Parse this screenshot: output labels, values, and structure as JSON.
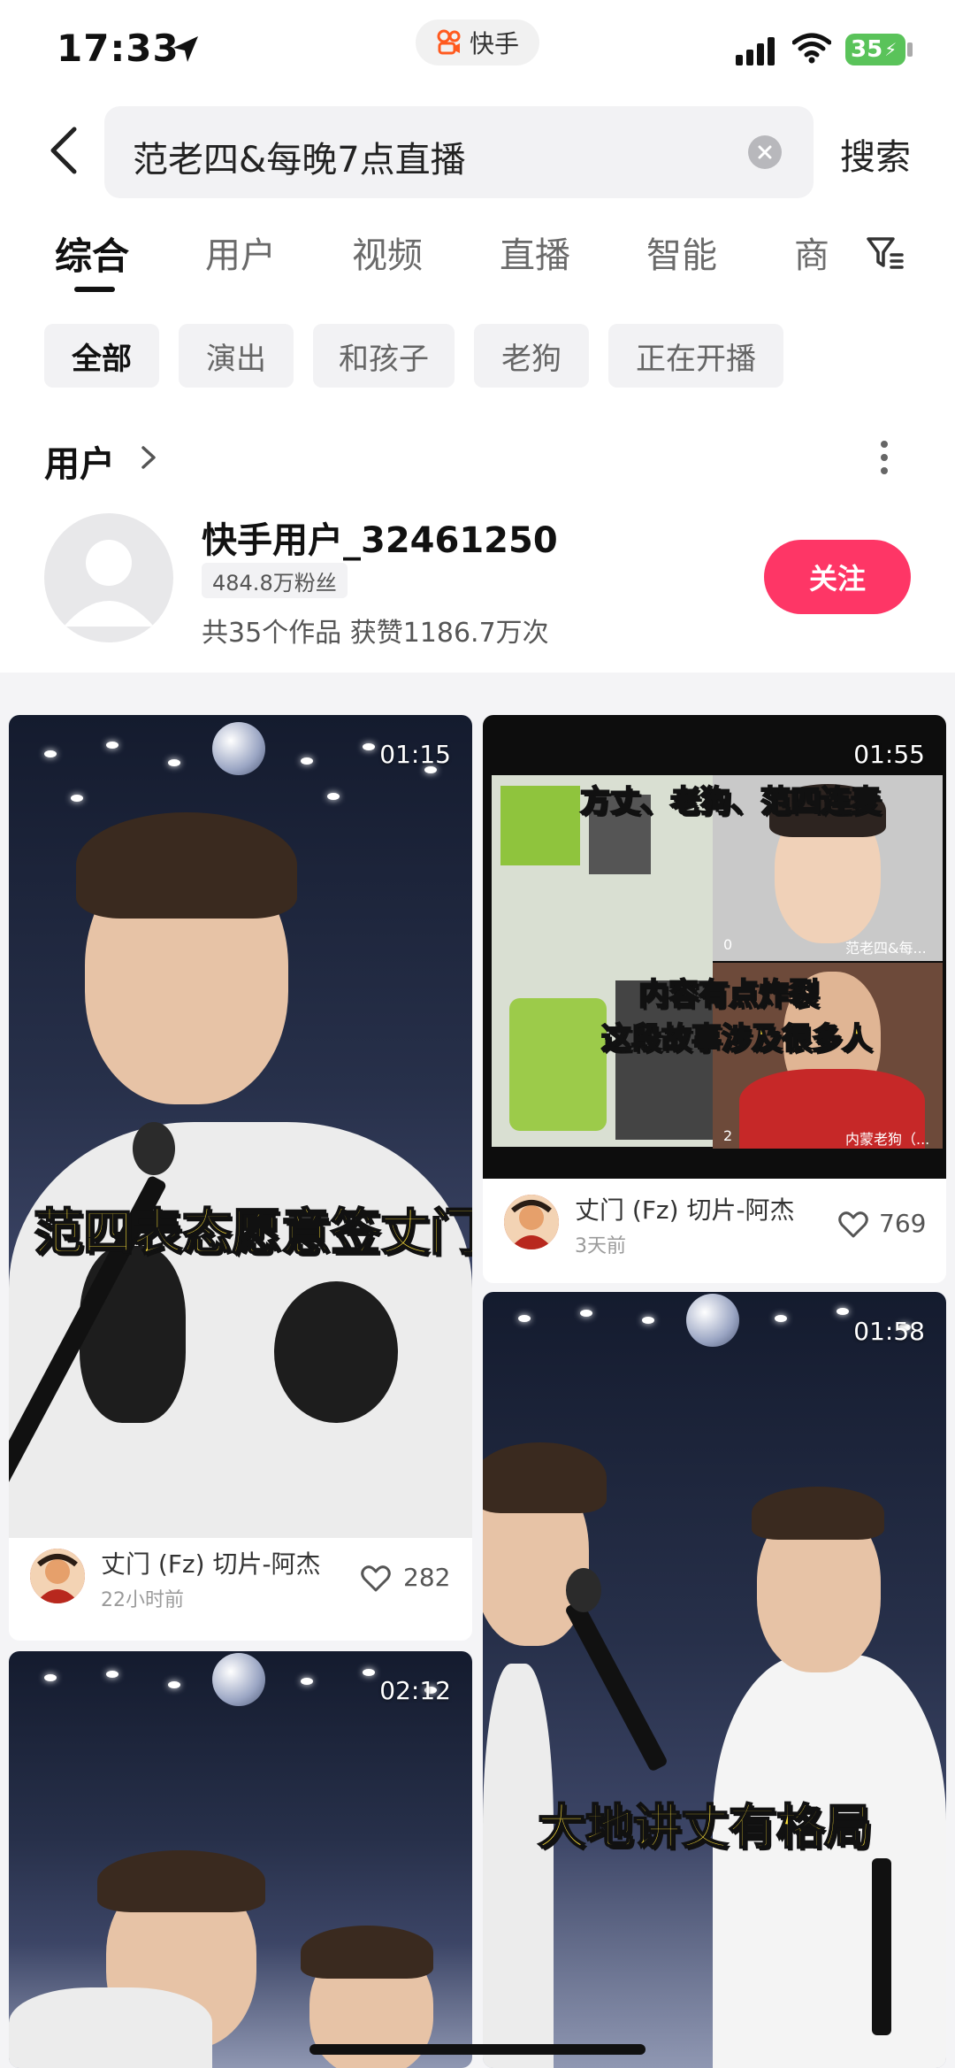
{
  "status_bar": {
    "time": "17:33",
    "app_name": "快手",
    "battery": "35",
    "icons": [
      "location-arrow-icon",
      "signal-icon",
      "wifi-icon",
      "battery-icon"
    ]
  },
  "search": {
    "query": "范老四&每晚7点直播",
    "submit_label": "搜索"
  },
  "tabs": [
    {
      "label": "综合",
      "active": true
    },
    {
      "label": "用户",
      "active": false
    },
    {
      "label": "视频",
      "active": false
    },
    {
      "label": "直播",
      "active": false
    },
    {
      "label": "智能",
      "active": false
    },
    {
      "label": "商",
      "active": false
    }
  ],
  "chips": [
    {
      "label": "全部",
      "active": true
    },
    {
      "label": "演出",
      "active": false
    },
    {
      "label": "和孩子",
      "active": false
    },
    {
      "label": "老狗",
      "active": false
    },
    {
      "label": "正在开播",
      "active": false
    }
  ],
  "user_section": {
    "title": "用户",
    "user": {
      "name": "快手用户_32461250",
      "fans": "484.8万粉丝",
      "stats": "共35个作品 获赞1186.7万次",
      "follow_label": "关注"
    }
  },
  "videos": [
    {
      "duration": "01:15",
      "caption": "范四表态愿意签丈门",
      "author": "丈门 (Fz) 切片-阿杰",
      "time": "22小时前",
      "likes": "282"
    },
    {
      "duration": "01:55",
      "caption_top": "方丈、老狗、范四连麦",
      "caption_mid": "内容有点炸裂",
      "caption_bot": "这段故事涉及很多人",
      "overlay_name_1": "范老四&每...",
      "overlay_name_2": "内蒙老狗（...",
      "overlay_count_1": "0",
      "overlay_count_2": "2",
      "author": "丈门 (Fz) 切片-阿杰",
      "time": "3天前",
      "likes": "769"
    },
    {
      "duration": "01:58",
      "caption": "大地讲丈有格局"
    },
    {
      "duration": "02:12"
    }
  ],
  "colors": {
    "accent": "#fe3666",
    "caption_yellow": "#ffe23a",
    "chip_bg": "#f2f2f4"
  }
}
